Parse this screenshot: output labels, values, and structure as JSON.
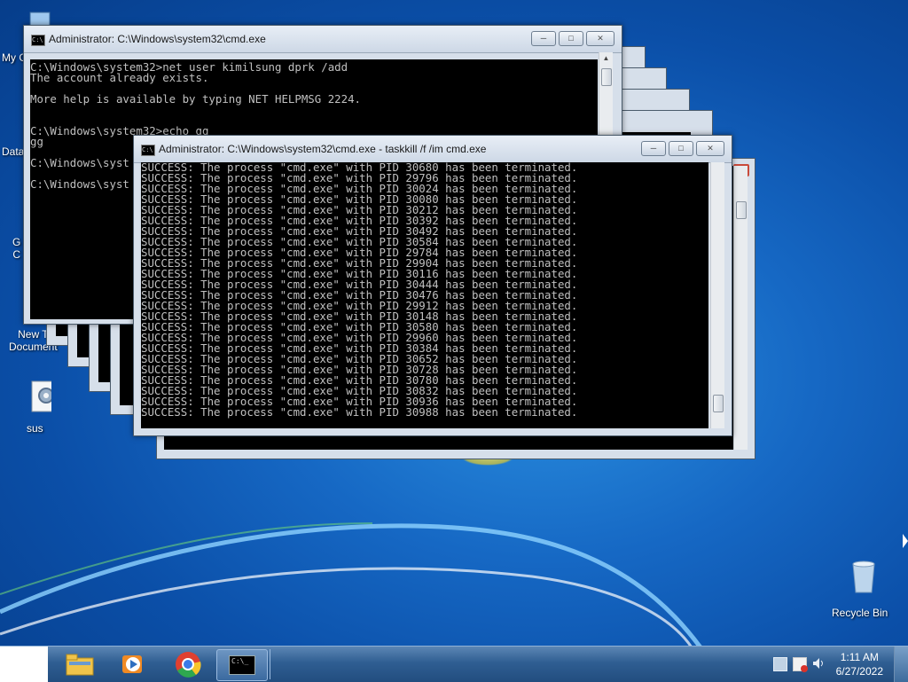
{
  "desktop": {
    "icons": [
      {
        "name": "my-computer",
        "label": "My C"
      },
      {
        "name": "data",
        "label": "Data"
      },
      {
        "name": "chrome-shortcut",
        "label": "G\nC"
      },
      {
        "name": "new-text-document",
        "label": "New T\nDocument"
      },
      {
        "name": "sus",
        "label": "sus"
      },
      {
        "name": "recycle-bin",
        "label": "Recycle Bin"
      }
    ]
  },
  "window_back": {
    "title": "Administrator: C:\\Windows\\system32\\cmd.exe",
    "lines": [
      "C:\\Windows\\system32>net user kimilsung dprk /add",
      "The account already exists.",
      "",
      "More help is available by typing NET HELPMSG 2224.",
      "",
      "",
      "C:\\Windows\\system32>echo gg",
      "gg",
      "",
      "C:\\Windows\\syst",
      "",
      "C:\\Windows\\syst"
    ]
  },
  "window_front": {
    "title": "Administrator: C:\\Windows\\system32\\cmd.exe - taskkill  /f /im cmd.exe",
    "lines": [
      "SUCCESS: The process \"cmd.exe\" with PID 30680 has been terminated.",
      "SUCCESS: The process \"cmd.exe\" with PID 29796 has been terminated.",
      "SUCCESS: The process \"cmd.exe\" with PID 30024 has been terminated.",
      "SUCCESS: The process \"cmd.exe\" with PID 30080 has been terminated.",
      "SUCCESS: The process \"cmd.exe\" with PID 30212 has been terminated.",
      "SUCCESS: The process \"cmd.exe\" with PID 30392 has been terminated.",
      "SUCCESS: The process \"cmd.exe\" with PID 30492 has been terminated.",
      "SUCCESS: The process \"cmd.exe\" with PID 30584 has been terminated.",
      "SUCCESS: The process \"cmd.exe\" with PID 29784 has been terminated.",
      "SUCCESS: The process \"cmd.exe\" with PID 29904 has been terminated.",
      "SUCCESS: The process \"cmd.exe\" with PID 30116 has been terminated.",
      "SUCCESS: The process \"cmd.exe\" with PID 30444 has been terminated.",
      "SUCCESS: The process \"cmd.exe\" with PID 30476 has been terminated.",
      "SUCCESS: The process \"cmd.exe\" with PID 29912 has been terminated.",
      "SUCCESS: The process \"cmd.exe\" with PID 30148 has been terminated.",
      "SUCCESS: The process \"cmd.exe\" with PID 30580 has been terminated.",
      "SUCCESS: The process \"cmd.exe\" with PID 29960 has been terminated.",
      "SUCCESS: The process \"cmd.exe\" with PID 30384 has been terminated.",
      "SUCCESS: The process \"cmd.exe\" with PID 30652 has been terminated.",
      "SUCCESS: The process \"cmd.exe\" with PID 30728 has been terminated.",
      "SUCCESS: The process \"cmd.exe\" with PID 30780 has been terminated.",
      "SUCCESS: The process \"cmd.exe\" with PID 30832 has been terminated.",
      "SUCCESS: The process \"cmd.exe\" with PID 30936 has been terminated.",
      "SUCCESS: The process \"cmd.exe\" with PID 30988 has been terminated."
    ]
  },
  "taskbar": {
    "pinned": [
      "explorer-icon",
      "media-player-icon",
      "chrome-icon",
      "cmd-icon"
    ],
    "clock_time": "1:11 AM",
    "clock_date": "6/27/2022"
  },
  "colors": {
    "console_bg": "#000000",
    "console_fg": "#c0c0c0",
    "desktop_blue": "#1668c4"
  }
}
